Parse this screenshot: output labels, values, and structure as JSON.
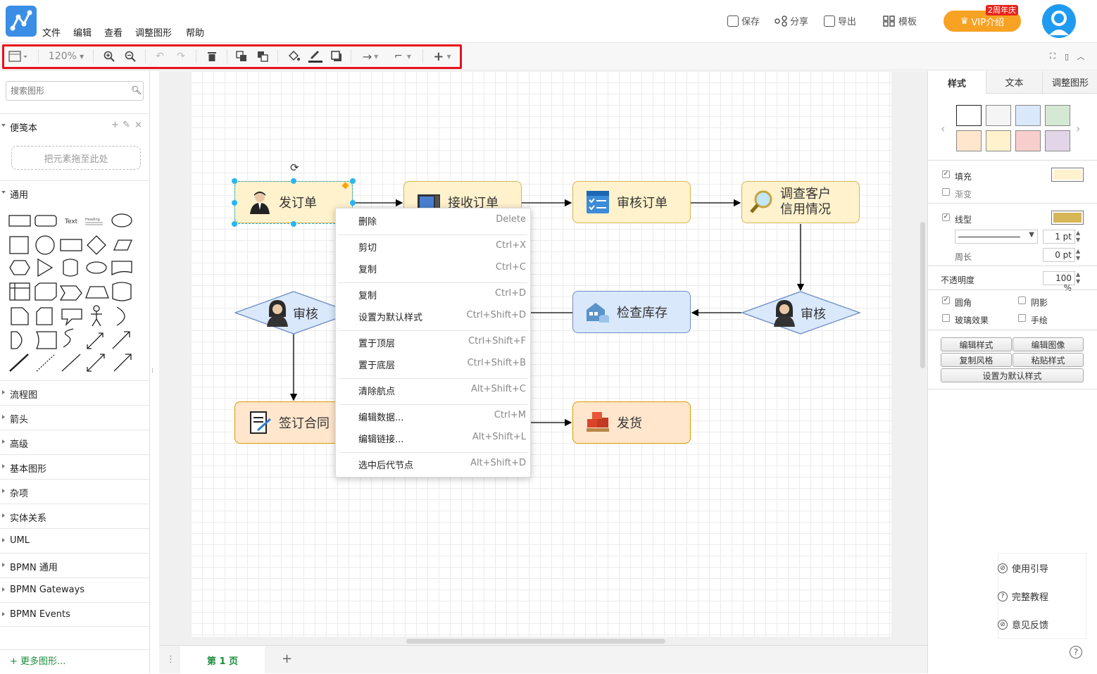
{
  "menu": [
    "文件",
    "编辑",
    "查看",
    "调整图形",
    "帮助"
  ],
  "top_actions": {
    "save": "保存",
    "share": "分享",
    "export": "导出",
    "templates": "模板"
  },
  "vip": {
    "label": "VIP介绍",
    "badge": "2周年庆"
  },
  "toolbar": {
    "zoom": "120%"
  },
  "sidebar": {
    "search_placeholder": "搜索图形",
    "scratchpad": "便笺本",
    "dropzone": "把元素拖至此处",
    "general": "通用",
    "shape_text": "Text",
    "shape_heading": "Heading",
    "sections": [
      "流程图",
      "箭头",
      "高级",
      "基本图形",
      "杂项",
      "实体关系",
      "UML",
      "BPMN 通用",
      "BPMN Gateways",
      "BPMN Events"
    ],
    "more": "+ 更多图形..."
  },
  "diagram": {
    "nodes": {
      "n1": "发订单",
      "n2": "接收订单",
      "n3": "审核订单",
      "n4a": "调查客户",
      "n4b": "信用情况",
      "n5": "审核",
      "n6": "检查库存",
      "n7": "审核",
      "n8": "签订合同",
      "n9": "发货"
    }
  },
  "context_menu": [
    {
      "label": "删除",
      "shortcut": "Delete"
    },
    {
      "label": "剪切",
      "shortcut": "Ctrl+X"
    },
    {
      "label": "复制",
      "shortcut": "Ctrl+C"
    },
    {
      "label": "复制",
      "shortcut": "Ctrl+D"
    },
    {
      "label": "设置为默认样式",
      "shortcut": "Ctrl+Shift+D"
    },
    {
      "label": "置于顶层",
      "shortcut": "Ctrl+Shift+F"
    },
    {
      "label": "置于底层",
      "shortcut": "Ctrl+Shift+B"
    },
    {
      "label": "清除航点",
      "shortcut": "Alt+Shift+C"
    },
    {
      "label": "编辑数据...",
      "shortcut": "Ctrl+M"
    },
    {
      "label": "编辑链接...",
      "shortcut": "Alt+Shift+L"
    },
    {
      "label": "选中后代节点",
      "shortcut": "Alt+Shift+D"
    }
  ],
  "page_tab": "第 1 页",
  "right_panel": {
    "tabs": [
      "样式",
      "文本",
      "调整图形"
    ],
    "swatches": [
      "#ffffff",
      "#f5f5f5",
      "#dae8fc",
      "#d5e8d4",
      "#ffe6cc",
      "#fff2cc",
      "#f8cecc",
      "#e1d5e7"
    ],
    "fill_label": "填充",
    "gradient_label": "渐变",
    "fill_color": "#fff2cc",
    "line_color": "#d6b656",
    "line_label": "线型",
    "line_width": "1 pt",
    "perimeter_label": "周长",
    "perimeter_value": "0 pt",
    "opacity_label": "不透明度",
    "opacity_value": "100 %",
    "rounded": "圆角",
    "shadow": "阴影",
    "glass": "玻璃效果",
    "sketch": "手绘",
    "btn_edit_style": "编辑样式",
    "btn_edit_image": "编辑图像",
    "btn_copy_style": "复制风格",
    "btn_paste_style": "粘贴样式",
    "btn_set_default": "设置为默认样式"
  },
  "help": {
    "guide": "使用引导",
    "tutorial": "完整教程",
    "feedback": "意见反馈"
  }
}
